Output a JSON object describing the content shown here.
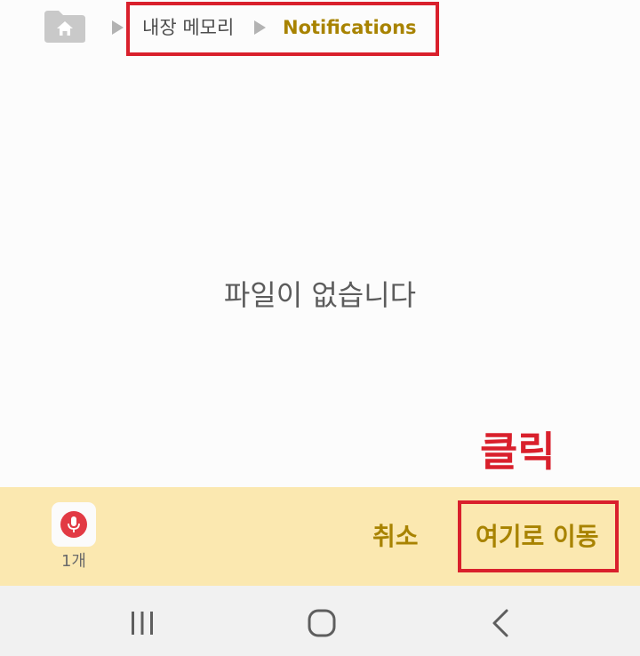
{
  "breadcrumb": {
    "home_icon": "home-folder-icon",
    "separator_icon": "triangle-right-icon",
    "items": [
      {
        "label": "내장 메모리"
      },
      {
        "label": "Notifications"
      }
    ]
  },
  "main": {
    "empty_message": "파일이 없습니다"
  },
  "annotation": {
    "click_label": "클릭",
    "color": "#d9202c"
  },
  "action_bar": {
    "file_icon": "voice-recorder-icon",
    "selected_count": "1개",
    "cancel_label": "취소",
    "move_here_label": "여기로 이동",
    "accent_color": "#a88300",
    "background": "#fbe8b0"
  },
  "nav_bar": {
    "recents_icon": "recents-icon",
    "home_icon": "home-circle-icon",
    "back_icon": "back-chevron-icon"
  }
}
